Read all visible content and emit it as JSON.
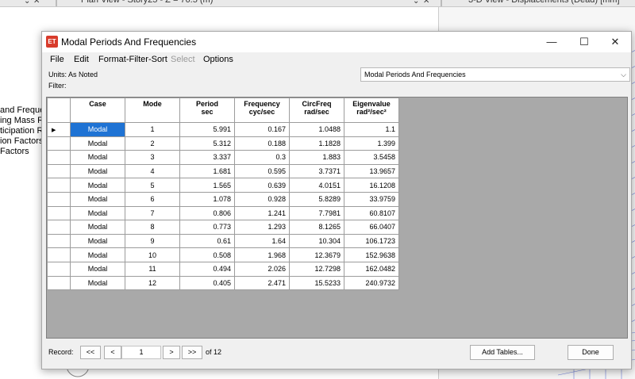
{
  "background": {
    "tab_left": "Plan View - Story25 - Z = 76.5 (m)",
    "tab_right": "3-D View  - Displacements (Dead)  [mm]",
    "left_items": [
      "and Frequenci",
      "ing Mass Rati",
      "ticipation Rati",
      "ion Factors",
      "Factors"
    ]
  },
  "dialog": {
    "icon_text": "ET",
    "title": "Modal Periods And Frequencies",
    "window_controls": {
      "minimize": "—",
      "maximize": "☐",
      "close": "✕"
    },
    "menu": [
      "File",
      "Edit",
      "Format-Filter-Sort",
      "Select",
      "Options"
    ],
    "units_label": "Units:  As Noted",
    "filter_label": "Filter:",
    "table_select": "Modal Periods And Frequencies",
    "grid": {
      "columns": [
        {
          "l1": "Case",
          "l2": ""
        },
        {
          "l1": "Mode",
          "l2": ""
        },
        {
          "l1": "Period",
          "l2": "sec"
        },
        {
          "l1": "Frequency",
          "l2": "cyc/sec"
        },
        {
          "l1": "CircFreq",
          "l2": "rad/sec"
        },
        {
          "l1": "Eigenvalue",
          "l2": "rad²/sec²"
        }
      ],
      "rows": [
        [
          "Modal",
          "1",
          "5.991",
          "0.167",
          "1.0488",
          "1.1"
        ],
        [
          "Modal",
          "2",
          "5.312",
          "0.188",
          "1.1828",
          "1.399"
        ],
        [
          "Modal",
          "3",
          "3.337",
          "0.3",
          "1.883",
          "3.5458"
        ],
        [
          "Modal",
          "4",
          "1.681",
          "0.595",
          "3.7371",
          "13.9657"
        ],
        [
          "Modal",
          "5",
          "1.565",
          "0.639",
          "4.0151",
          "16.1208"
        ],
        [
          "Modal",
          "6",
          "1.078",
          "0.928",
          "5.8289",
          "33.9759"
        ],
        [
          "Modal",
          "7",
          "0.806",
          "1.241",
          "7.7981",
          "60.8107"
        ],
        [
          "Modal",
          "8",
          "0.773",
          "1.293",
          "8.1265",
          "66.0407"
        ],
        [
          "Modal",
          "9",
          "0.61",
          "1.64",
          "10.304",
          "106.1723"
        ],
        [
          "Modal",
          "10",
          "0.508",
          "1.968",
          "12.3679",
          "152.9638"
        ],
        [
          "Modal",
          "11",
          "0.494",
          "2.026",
          "12.7298",
          "162.0482"
        ],
        [
          "Modal",
          "12",
          "0.405",
          "2.471",
          "15.5233",
          "240.9732"
        ]
      ],
      "current_row_marker": "▶"
    },
    "footer": {
      "record_label": "Record:",
      "first": "<<",
      "prev": "<",
      "record_value": "1",
      "next": ">",
      "last": ">>",
      "of_label": "of 12",
      "add_tables": "Add Tables...",
      "done": "Done"
    }
  }
}
